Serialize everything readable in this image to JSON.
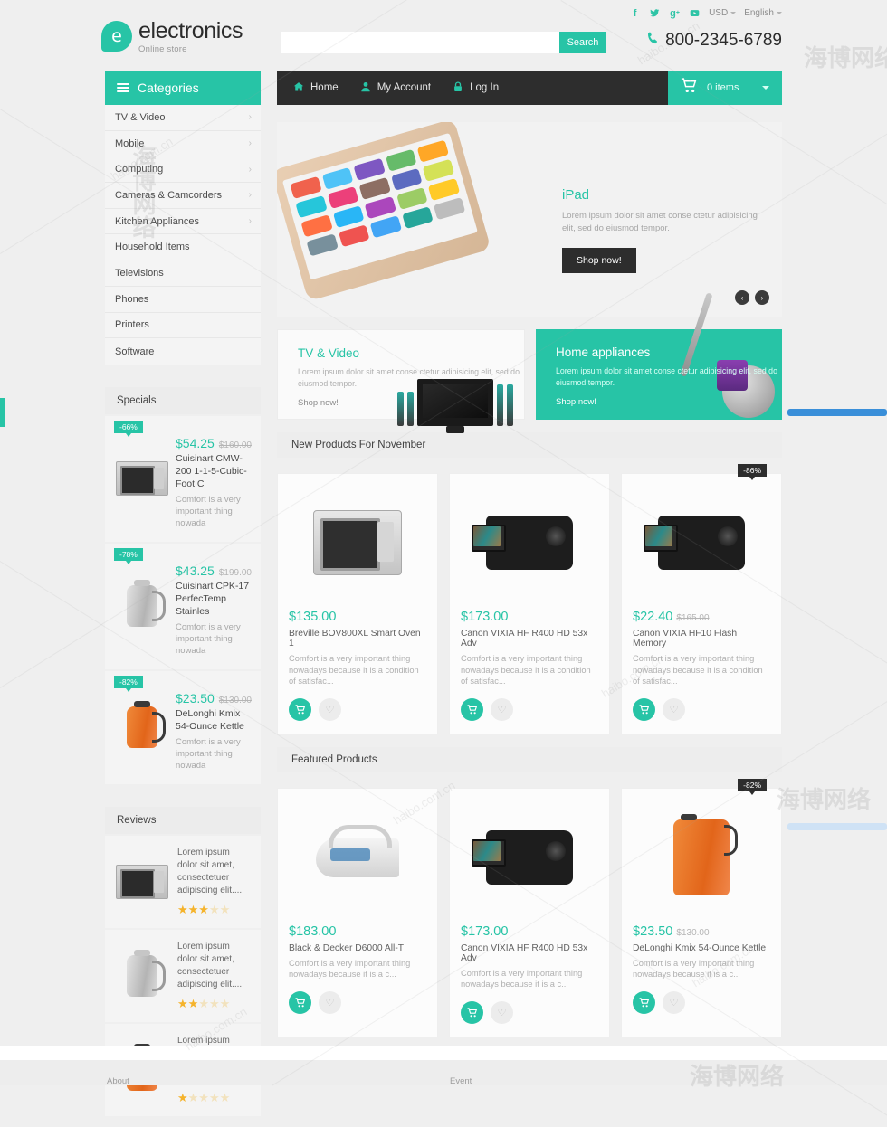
{
  "brand": {
    "logo_letter": "e",
    "name": "electronics",
    "tagline": "Online store"
  },
  "topbar": {
    "social": [
      {
        "name": "facebook-icon",
        "glyph": "f"
      },
      {
        "name": "twitter-icon",
        "glyph": "ᵗ"
      },
      {
        "name": "google-plus-icon",
        "glyph": "g"
      },
      {
        "name": "youtube-icon",
        "glyph": "▶"
      }
    ],
    "currency": "USD",
    "language": "English",
    "phone": "800-2345-6789"
  },
  "search": {
    "value": "",
    "placeholder": "",
    "button_label": "Search"
  },
  "nav": {
    "items": [
      {
        "label": "Home",
        "icon": "home-icon",
        "glyph": "⌂"
      },
      {
        "label": "My Account",
        "icon": "user-icon",
        "glyph": "♟"
      },
      {
        "label": "Log In",
        "icon": "lock-icon",
        "glyph": "⚿"
      }
    ],
    "cart_label": "0 items"
  },
  "sidebar": {
    "categories_title": "Categories",
    "categories": [
      {
        "label": "TV & Video",
        "has_sub": true
      },
      {
        "label": "Mobile",
        "has_sub": true
      },
      {
        "label": "Computing",
        "has_sub": true
      },
      {
        "label": "Cameras & Camcorders",
        "has_sub": true
      },
      {
        "label": "Kitchen Appliances",
        "has_sub": true
      },
      {
        "label": "Household Items",
        "has_sub": false
      },
      {
        "label": "Televisions",
        "has_sub": false
      },
      {
        "label": "Phones",
        "has_sub": false
      },
      {
        "label": "Printers",
        "has_sub": false
      },
      {
        "label": "Software",
        "has_sub": false
      }
    ],
    "specials_title": "Specials",
    "specials": [
      {
        "discount": "-66%",
        "price": "$54.25",
        "price_old": "$160.00",
        "name": "Cuisinart CMW-200 1-1-5-Cubic-Foot C",
        "desc": "Comfort is a very important thing nowada",
        "image": "microwave"
      },
      {
        "discount": "-78%",
        "price": "$43.25",
        "price_old": "$199.00",
        "name": "Cuisinart CPK-17 PerfecTemp Stainles",
        "desc": "Comfort is a very important thing nowada",
        "image": "kettle-steel"
      },
      {
        "discount": "-82%",
        "price": "$23.50",
        "price_old": "$130.00",
        "name": "DeLonghi Kmix 54-Ounce Kettle",
        "desc": "Comfort is a very important thing nowada",
        "image": "kettle-orange"
      }
    ],
    "reviews_title": "Reviews",
    "reviews": [
      {
        "text": "Lorem ipsum dolor sit amet, consectetuer adipiscing elit....",
        "rating": 3,
        "max": 5,
        "image": "microwave"
      },
      {
        "text": "Lorem ipsum dolor sit amet, consectetuer adipiscing elit....",
        "rating": 2,
        "max": 5,
        "image": "kettle-steel"
      },
      {
        "text": "Lorem ipsum dolor sit amet, consectetuer adipiscing elit....",
        "rating": 1,
        "max": 5,
        "image": "kettle-orange"
      }
    ]
  },
  "hero": {
    "title": "iPad",
    "text": "Lorem ipsum dolor sit amet conse ctetur adipisicing elit, sed do eiusmod tempor.",
    "button": "Shop now!",
    "prev": "‹",
    "next": "›"
  },
  "promos": [
    {
      "title": "TV & Video",
      "text": "Lorem ipsum dolor sit amet conse ctetur adipisicing elit, sed do eiusmod tempor.",
      "link": "Shop now!",
      "style": "light"
    },
    {
      "title": "Home appliances",
      "text": "Lorem ipsum dolor sit amet conse ctetur adipisicing elit, sed do eiusmod tempor.",
      "link": "Shop now!",
      "style": "teal"
    }
  ],
  "sections": [
    {
      "title": "New Products For November",
      "products": [
        {
          "price": "$135.00",
          "price_old": "",
          "discount": "",
          "name": "Breville BOV800XL Smart Oven 1",
          "desc": "Comfort is a very important thing nowadays because it is a condition of satisfac...",
          "image": "oven"
        },
        {
          "price": "$173.00",
          "price_old": "",
          "discount": "",
          "name": "Canon VIXIA HF R400 HD 53x Adv",
          "desc": "Comfort is a very important thing nowadays because it is a condition of satisfac...",
          "image": "camcorder"
        },
        {
          "price": "$22.40",
          "price_old": "$165.00",
          "discount": "-86%",
          "name": "Canon VIXIA HF10 Flash Memory",
          "desc": "Comfort is a very important thing nowadays because it is a condition of satisfac...",
          "image": "camcorder-black"
        }
      ]
    },
    {
      "title": "Featured Products",
      "products": [
        {
          "price": "$183.00",
          "price_old": "",
          "discount": "",
          "name": "Black & Decker D6000 All-T",
          "desc": "Comfort is a very important thing nowadays because it is a c...",
          "image": "iron"
        },
        {
          "price": "$173.00",
          "price_old": "",
          "discount": "",
          "name": "Canon VIXIA HF R400 HD 53x Adv",
          "desc": "Comfort is a very important thing nowadays because it is a c...",
          "image": "camcorder"
        },
        {
          "price": "$23.50",
          "price_old": "$130.00",
          "discount": "-82%",
          "name": "DeLonghi Kmix 54-Ounce Kettle",
          "desc": "Comfort is a very important thing nowadays because it is a c...",
          "image": "kettle-orange"
        }
      ]
    }
  ],
  "product_actions": {
    "add_to_cart": "Ὥ2",
    "wishlist": "♡"
  },
  "footer": {
    "col_a": "About",
    "col_b": "Event"
  },
  "watermarks": {
    "latin": "haibo.com.cn",
    "cjk": "海博网络"
  },
  "colors": {
    "accent": "#27c4a6",
    "dark": "#2d2d2d",
    "page_bg": "#efefef",
    "star_on": "#f5b32b",
    "edge_blue": "#3a8fd9",
    "edge_blue_light": "#cfe2f5"
  }
}
